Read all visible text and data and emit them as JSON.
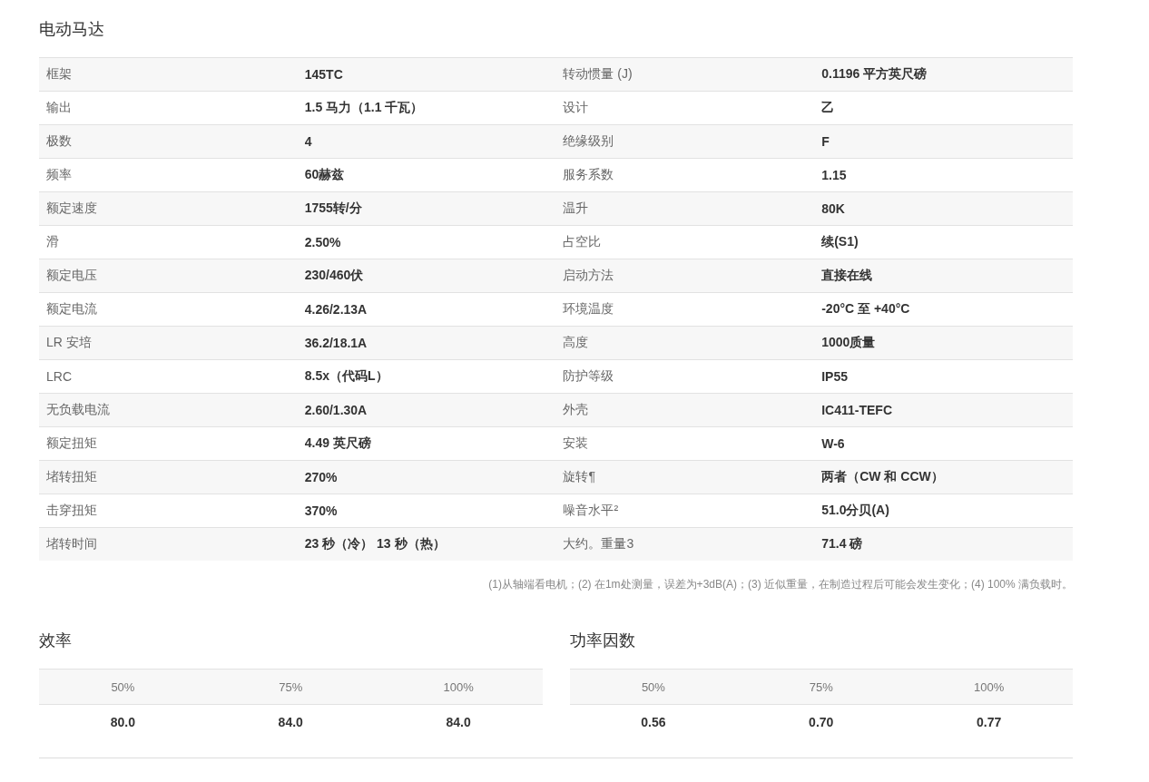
{
  "title": "电动马达",
  "spec_rows": [
    [
      "框架",
      "145TC",
      "转动惯量 (J)",
      "0.1196 平方英尺磅"
    ],
    [
      "输出",
      "1.5 马力（1.1 千瓦）",
      "设计",
      "乙"
    ],
    [
      "极数",
      "4",
      "绝缘级别",
      "F"
    ],
    [
      "频率",
      "60赫兹",
      "服务系数",
      "1.15"
    ],
    [
      "额定速度",
      "1755转/分",
      "温升",
      "80K"
    ],
    [
      "滑",
      "2.50%",
      "占空比",
      "续(S1)"
    ],
    [
      "额定电压",
      "230/460伏",
      "启动方法",
      "直接在线"
    ],
    [
      "额定电流",
      "4.26/2.13A",
      "环境温度",
      "-20°C 至 +40°C"
    ],
    [
      "LR 安培",
      "36.2/18.1A",
      "高度",
      "1000质量"
    ],
    [
      "LRC",
      "8.5x（代码L）",
      "防护等级",
      "IP55"
    ],
    [
      "无负载电流",
      "2.60/1.30A",
      "外壳",
      "IC411-TEFC"
    ],
    [
      "额定扭矩",
      "4.49 英尺磅",
      "安装",
      "W-6"
    ],
    [
      "堵转扭矩",
      "270%",
      "旋转¶",
      "两者（CW 和 CCW）"
    ],
    [
      "击穿扭矩",
      "370%",
      "噪音水平²",
      "51.0分贝(A)"
    ],
    [
      "堵转时间",
      "23 秒（冷） 13 秒（热）",
      "大约。重量3",
      "71.4 磅"
    ]
  ],
  "footnote": "(1)从轴端看电机；(2) 在1m处测量，误差为+3dB(A)；(3) 近似重量，在制造过程后可能会发生变化；(4) 100% 满负载时。",
  "metric_tables": [
    {
      "title": "效率",
      "columns": [
        "50%",
        "75%",
        "100%"
      ],
      "values": [
        "80.0",
        "84.0",
        "84.0"
      ]
    },
    {
      "title": "功率因数",
      "columns": [
        "50%",
        "75%",
        "100%"
      ],
      "values": [
        "0.56",
        "0.70",
        "0.77"
      ]
    }
  ]
}
